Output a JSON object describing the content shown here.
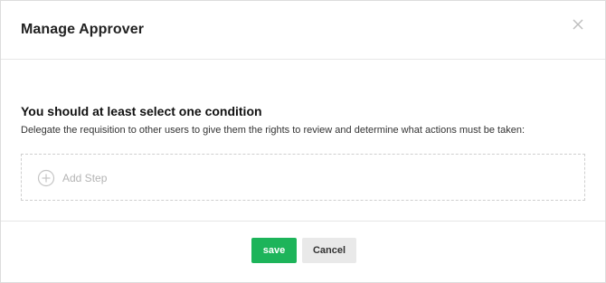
{
  "modal": {
    "title": "Manage Approver",
    "close_icon": "close-icon"
  },
  "body": {
    "section_title": "You should at least select one condition",
    "description": "Delegate the requisition to other users to give them the rights to review and determine what actions must be taken:",
    "add_step": {
      "icon": "plus-circle-icon",
      "label": "Add Step"
    }
  },
  "footer": {
    "save_label": "save",
    "cancel_label": "Cancel"
  },
  "colors": {
    "save_button": "#1db45a",
    "cancel_button": "#e9e9e9",
    "muted_text": "#b4b4b4"
  }
}
